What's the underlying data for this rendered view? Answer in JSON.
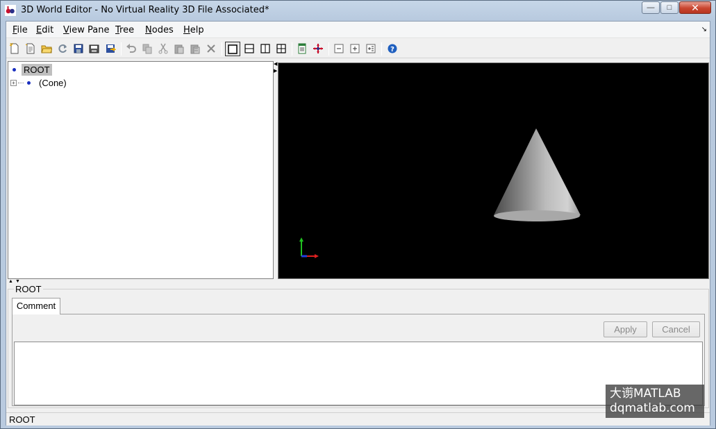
{
  "window": {
    "title": "3D World Editor - No Virtual Reality 3D File Associated*",
    "controls": {
      "minimize": "—",
      "maximize": "□",
      "close": "✕"
    }
  },
  "menu": {
    "items": [
      {
        "u": "F",
        "rest": "ile"
      },
      {
        "u": "E",
        "rest": "dit"
      },
      {
        "u": "V",
        "rest": "iew Pane"
      },
      {
        "u": "T",
        "rest": "ree"
      },
      {
        "u": "N",
        "rest": "odes"
      },
      {
        "u": "H",
        "rest": "elp"
      }
    ],
    "corner_glyph": "↘"
  },
  "toolbar": {
    "icons": [
      "new-file-icon",
      "new-from-template-icon",
      "open-folder-icon",
      "reload-icon",
      "save-icon",
      "save-as-icon",
      "export-icon",
      "undo-icon",
      "copy-icon",
      "cut-icon",
      "paste-icon",
      "paste-special-icon",
      "delete-icon",
      "single-pane-icon",
      "horizontal-split-icon",
      "vertical-split-icon",
      "quad-split-icon",
      "properties-icon",
      "navigation-icon",
      "collapse-icon",
      "expand-icon",
      "expand-all-icon",
      "help-icon"
    ]
  },
  "tree": {
    "root_label": "ROOT",
    "children": [
      {
        "label": "(Cone)",
        "expandable": true
      }
    ]
  },
  "properties": {
    "group_title": "ROOT",
    "tab_label": "Comment",
    "apply_label": "Apply",
    "cancel_label": "Cancel",
    "comment_value": ""
  },
  "status": {
    "text": "ROOT"
  },
  "watermark": {
    "line1": "大谫MATLAB",
    "line2": "dqmatlab.com"
  },
  "colors": {
    "viewport_bg": "#000000",
    "axis_x": "#e02020",
    "axis_y": "#20c020",
    "axis_z": "#2040e0",
    "tree_node": "#1a2fbf"
  }
}
